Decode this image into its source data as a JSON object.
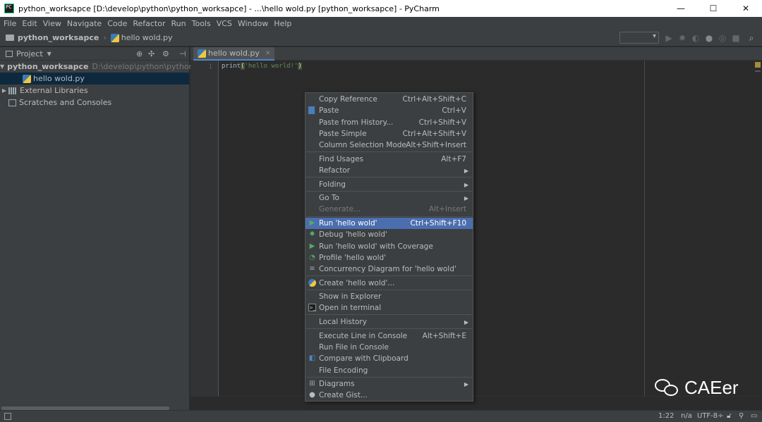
{
  "window": {
    "title": "python_worksapce [D:\\develop\\python\\python_worksapce] - ...\\hello wold.py [python_worksapce] - PyCharm",
    "minimize": "—",
    "maximize": "☐",
    "close": "✕"
  },
  "menubar": [
    "File",
    "Edit",
    "View",
    "Navigate",
    "Code",
    "Refactor",
    "Run",
    "Tools",
    "VCS",
    "Window",
    "Help"
  ],
  "navbar": {
    "project": "python_worksapce",
    "file": "hello wold.py"
  },
  "project_panel": {
    "title": "Project",
    "tree": [
      {
        "label": "python_worksapce",
        "path": "D:\\develop\\python\\python_wor"
      },
      {
        "label": "hello wold.py"
      },
      {
        "label": "External Libraries"
      },
      {
        "label": "Scratches and Consoles"
      }
    ]
  },
  "editor": {
    "tab": "hello wold.py",
    "line_number": "1",
    "code_func": "print",
    "code_open": "(",
    "code_string": "'hello world!'",
    "code_close": ")"
  },
  "context_menu": {
    "items": [
      {
        "label": "Copy Reference",
        "shortcut": "Ctrl+Alt+Shift+C"
      },
      {
        "label": "Paste",
        "shortcut": "Ctrl+V"
      },
      {
        "label": "Paste from History...",
        "shortcut": "Ctrl+Shift+V"
      },
      {
        "label": "Paste Simple",
        "shortcut": "Ctrl+Alt+Shift+V"
      },
      {
        "label": "Column Selection Mode",
        "shortcut": "Alt+Shift+Insert"
      },
      {
        "label": "Find Usages",
        "shortcut": "Alt+F7"
      },
      {
        "label": "Refactor",
        "shortcut": ""
      },
      {
        "label": "Folding",
        "shortcut": ""
      },
      {
        "label": "Go To",
        "shortcut": ""
      },
      {
        "label": "Generate...",
        "shortcut": "Alt+Insert"
      },
      {
        "label": "Run 'hello wold'",
        "shortcut": "Ctrl+Shift+F10"
      },
      {
        "label": "Debug 'hello wold'",
        "shortcut": ""
      },
      {
        "label": "Run 'hello wold' with Coverage",
        "shortcut": ""
      },
      {
        "label": "Profile 'hello wold'",
        "shortcut": ""
      },
      {
        "label": "Concurrency Diagram for 'hello wold'",
        "shortcut": ""
      },
      {
        "label": "Create 'hello wold'...",
        "shortcut": ""
      },
      {
        "label": "Show in Explorer",
        "shortcut": ""
      },
      {
        "label": "Open in terminal",
        "shortcut": ""
      },
      {
        "label": "Local History",
        "shortcut": ""
      },
      {
        "label": "Execute Line in Console",
        "shortcut": "Alt+Shift+E"
      },
      {
        "label": "Run File in Console",
        "shortcut": ""
      },
      {
        "label": "Compare with Clipboard",
        "shortcut": ""
      },
      {
        "label": "File Encoding",
        "shortcut": ""
      },
      {
        "label": "Diagrams",
        "shortcut": ""
      },
      {
        "label": "Create Gist...",
        "shortcut": ""
      }
    ]
  },
  "statusbar": {
    "position": "1:22",
    "line_sep": "n/a",
    "encoding": "UTF-8÷"
  },
  "watermark": {
    "text": "CAEer"
  },
  "colors": {
    "accent": "#4b6eaf",
    "background": "#2b2b2b",
    "panel": "#3c3f41"
  }
}
